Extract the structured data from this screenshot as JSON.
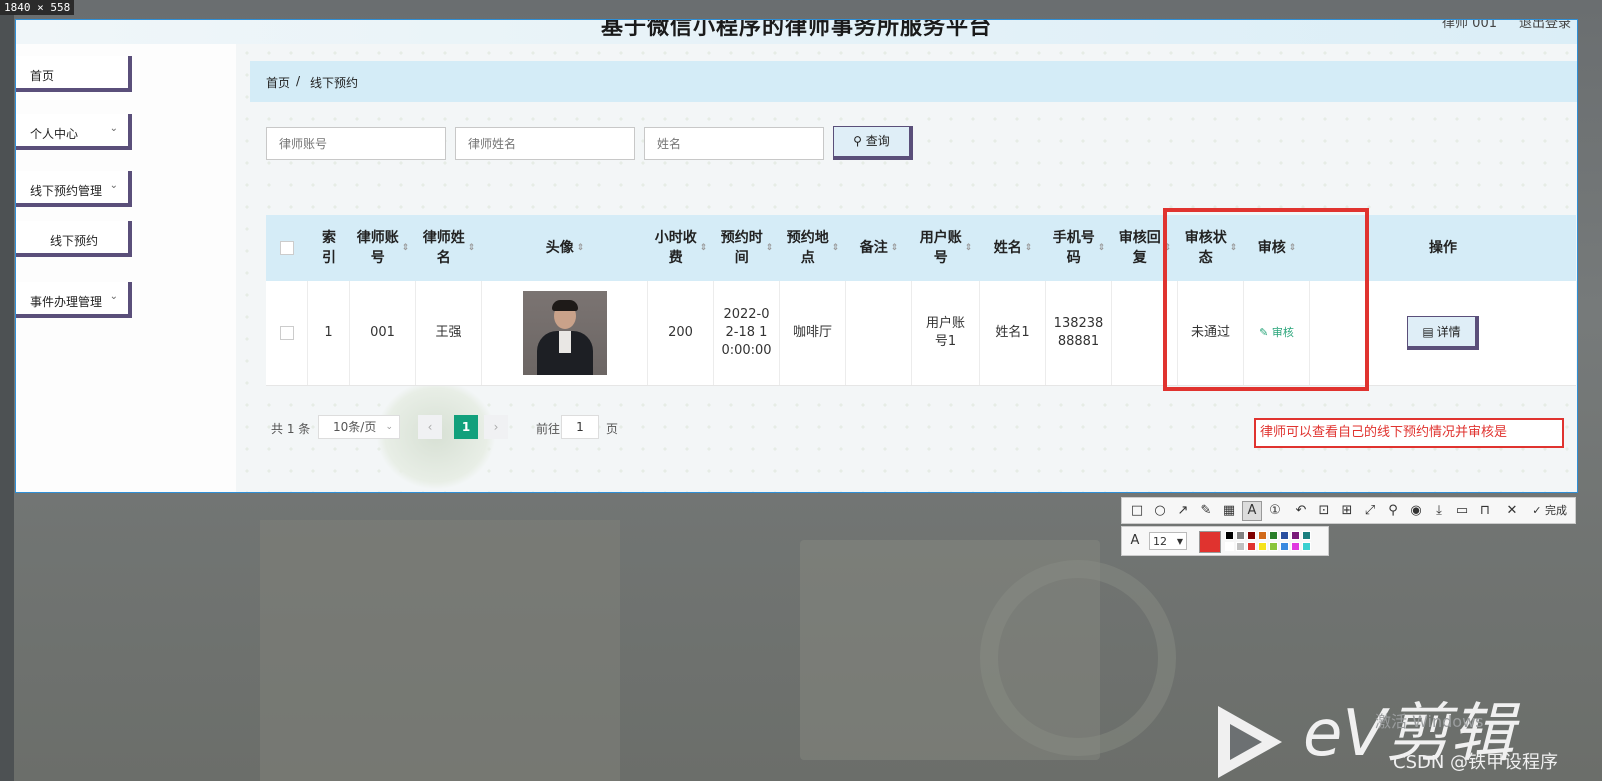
{
  "overlay": {
    "size_label": "1840 × 558"
  },
  "app": {
    "title": "基于微信小程序的律师事务所服务平台",
    "user": "律师 001",
    "logout": "退出登录"
  },
  "sidebar": {
    "items": [
      {
        "label": "首页",
        "has_chevron": false
      },
      {
        "label": "个人中心",
        "has_chevron": true
      },
      {
        "label": "线下预约管理",
        "has_chevron": true
      },
      {
        "label": "线下预约",
        "has_chevron": false
      },
      {
        "label": "事件办理管理",
        "has_chevron": true
      }
    ]
  },
  "breadcrumb": {
    "home": "首页",
    "separator": "/",
    "current": "线下预约"
  },
  "search": {
    "lawyer_account_placeholder": "律师账号",
    "lawyer_name_placeholder": "律师姓名",
    "name_placeholder": "姓名",
    "search_button": "查询"
  },
  "table": {
    "columns": {
      "index": "索引",
      "lawyer_account": "律师账号",
      "lawyer_name": "律师姓名",
      "avatar": "头像",
      "hourly_fee": "小时收费",
      "appointment_time": "预约时间",
      "location": "预约地点",
      "remark": "备注",
      "user_account": "用户账号",
      "name": "姓名",
      "phone": "手机号码",
      "audit_reply": "审核回复",
      "audit_status": "审核状态",
      "audit": "审核",
      "actions": "操作"
    },
    "rows": [
      {
        "index": "1",
        "lawyer_account": "001",
        "lawyer_name": "王强",
        "hourly_fee": "200",
        "appointment_time": "2022-02-18 10:00:00",
        "location": "咖啡厅",
        "remark": "",
        "user_account": "用户账号1",
        "name": "姓名1",
        "phone": "13823888881",
        "audit_reply": "",
        "audit_status": "未通过",
        "audit_action": "审核",
        "detail_action": "详情"
      }
    ]
  },
  "pagination": {
    "total": "共 1 条",
    "page_size": "10条/页",
    "current_page": "1",
    "goto_label": "前往",
    "goto_value": "1",
    "goto_suffix": "页"
  },
  "annotation": {
    "text": "律师可以查看自己的线下预约情况并审核是"
  },
  "editor_toolbar": {
    "font_size": "12",
    "done_label": "完成",
    "current_color": "#e0332f",
    "palette": [
      "#000000",
      "#808080",
      "#800000",
      "#d26a1a",
      "#2a7f2a",
      "#2a4fa0",
      "#7a1a7a",
      "#1a7f7f",
      "#ffffff",
      "#c0c0c0",
      "#e0332f",
      "#f5e31a",
      "#8ac53a",
      "#3a8ae0",
      "#e03ae0",
      "#3ad0d0"
    ]
  },
  "branding": {
    "ev_logo": "eV剪辑",
    "watermark": "CSDN @铁甲设程序",
    "activate_windows": "激活 Windows"
  }
}
